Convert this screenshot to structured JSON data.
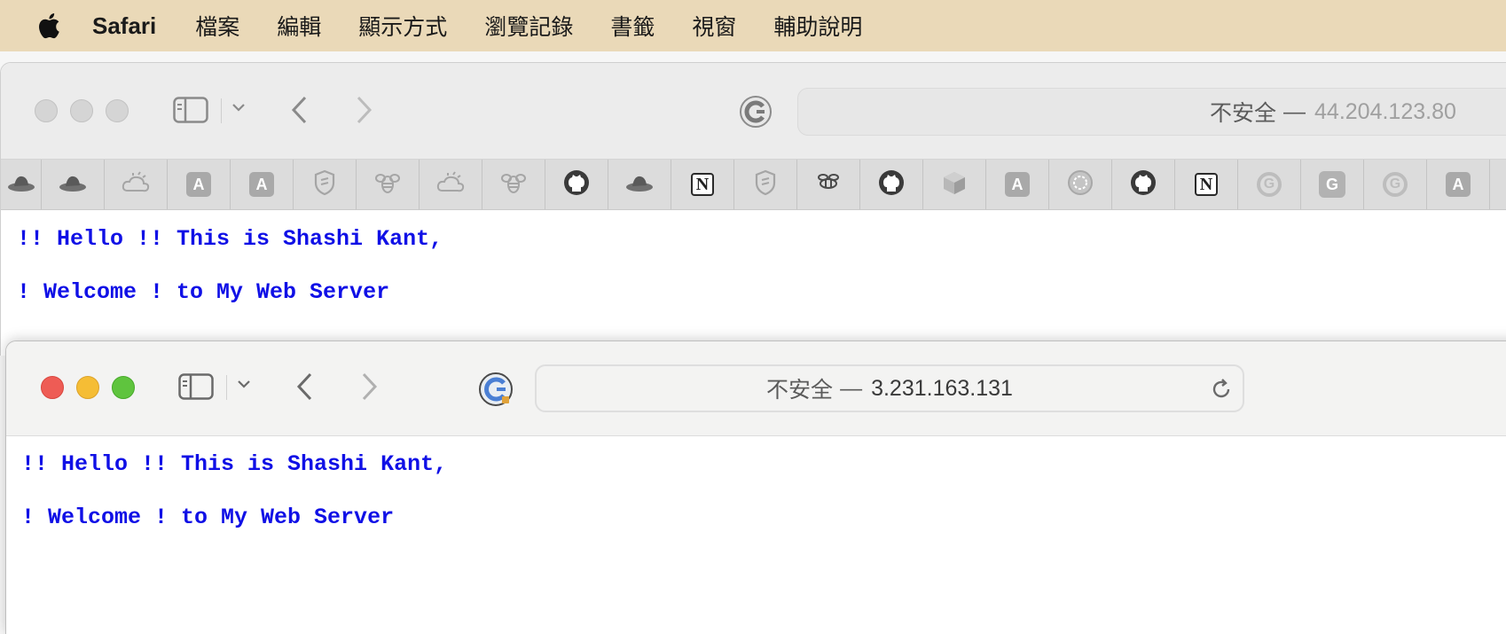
{
  "menubar": {
    "app": "Safari",
    "items": [
      "檔案",
      "編輯",
      "顯示方式",
      "瀏覽記錄",
      "書籤",
      "視窗",
      "輔助說明"
    ]
  },
  "back_window": {
    "address": {
      "label": "不安全",
      "separator": "—",
      "host": "44.204.123.80"
    },
    "bookmarks": [
      {
        "icon": "redhat-icon"
      },
      {
        "icon": "redhat-icon"
      },
      {
        "icon": "cloud-sun-icon"
      },
      {
        "icon": "letter-a-icon",
        "text": "A"
      },
      {
        "icon": "letter-a-icon",
        "text": "A"
      },
      {
        "icon": "shield-icon"
      },
      {
        "icon": "bee-icon"
      },
      {
        "icon": "cloud-sun-icon"
      },
      {
        "icon": "bee-icon"
      },
      {
        "icon": "github-icon"
      },
      {
        "icon": "redhat-icon"
      },
      {
        "icon": "notion-icon",
        "text": "N"
      },
      {
        "icon": "shield-icon"
      },
      {
        "icon": "bee-icon"
      },
      {
        "icon": "github-icon"
      },
      {
        "icon": "cube-icon"
      },
      {
        "icon": "letter-a-icon",
        "text": "A"
      },
      {
        "icon": "gear-badge-icon"
      },
      {
        "icon": "github-icon"
      },
      {
        "icon": "notion-icon",
        "text": "N"
      },
      {
        "icon": "google-icon",
        "text": "G"
      },
      {
        "icon": "google-box-icon",
        "text": "G"
      },
      {
        "icon": "google-icon",
        "text": "G"
      },
      {
        "icon": "letter-a-icon",
        "text": "A"
      }
    ],
    "page": {
      "line1": "!! Hello !! This is Shashi Kant,",
      "line2": "! Welcome ! to My Web Server"
    }
  },
  "front_window": {
    "address": {
      "label": "不安全",
      "separator": "—",
      "host": "3.231.163.131"
    },
    "page": {
      "line1": "!! Hello !! This is Shashi Kant,",
      "line2": "! Welcome ! to My Web Server"
    }
  },
  "colors": {
    "menubar": "#ead9b8",
    "page_text": "#1010e6",
    "close": "#ee5c55",
    "minimize": "#f5bd35",
    "zoom": "#5fc43e"
  }
}
